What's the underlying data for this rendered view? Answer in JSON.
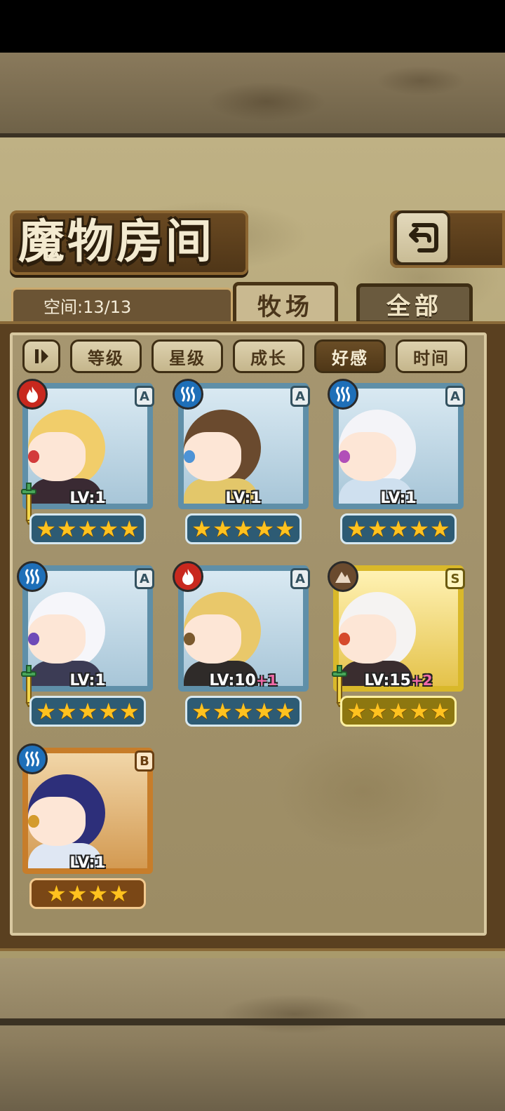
{
  "header": {
    "title": "魔物房间"
  },
  "space": {
    "label": "空间:13/13"
  },
  "tabs": [
    {
      "label": "牧场",
      "active": true
    },
    {
      "label": "全部",
      "active": false
    }
  ],
  "filters": [
    {
      "label": "等级",
      "active": false
    },
    {
      "label": "星级",
      "active": false
    },
    {
      "label": "成长",
      "active": false
    },
    {
      "label": "好感",
      "active": true
    },
    {
      "label": "时间",
      "active": false
    }
  ],
  "cards": [
    {
      "element": "fire",
      "grade": "A",
      "level": "LV:1",
      "plus": "",
      "stars": 5,
      "frame": "silver",
      "has_sword": true,
      "hair": "#f1cd6a",
      "eyes": "#d33b3b",
      "outfit": "#3a2a33"
    },
    {
      "element": "water",
      "grade": "A",
      "level": "LV:1",
      "plus": "",
      "stars": 5,
      "frame": "silver",
      "has_sword": false,
      "hair": "#6a4a2e",
      "eyes": "#4d93d6",
      "outfit": "#e3c76a"
    },
    {
      "element": "water",
      "grade": "A",
      "level": "LV:1",
      "plus": "",
      "stars": 5,
      "frame": "silver",
      "has_sword": false,
      "hair": "#f4f4f8",
      "eyes": "#b14fb8",
      "outfit": "#cfe0ef"
    },
    {
      "element": "water",
      "grade": "A",
      "level": "LV:1",
      "plus": "",
      "stars": 5,
      "frame": "silver",
      "has_sword": true,
      "hair": "#f6f6fa",
      "eyes": "#6f4bb8",
      "outfit": "#3c3c55"
    },
    {
      "element": "fire",
      "grade": "A",
      "level": "LV:10",
      "plus": "+1",
      "stars": 5,
      "frame": "silver",
      "has_sword": false,
      "hair": "#e9c86a",
      "eyes": "#7b5a2f",
      "outfit": "#2f2b29"
    },
    {
      "element": "earth",
      "grade": "S",
      "level": "LV:15",
      "plus": "+2",
      "stars": 5,
      "frame": "gold",
      "has_sword": true,
      "hair": "#f5f3f2",
      "eyes": "#d64a2c",
      "outfit": "#3a2d2f"
    },
    {
      "element": "water",
      "grade": "B",
      "level": "LV:1",
      "plus": "",
      "stars": 4,
      "frame": "bronze",
      "has_sword": false,
      "hair": "#2d2f7a",
      "eyes": "#d49b2c",
      "outfit": "#dfe7f3"
    }
  ],
  "colors": {
    "fire": "#c8281e",
    "water": "#1e6fb8",
    "earth": "#6a4a2e"
  },
  "icons": {
    "back": "return-arrow-icon",
    "toggle": "pause-sort-icon",
    "fire": "flame-icon",
    "water": "wave-icon",
    "earth": "mountain-icon",
    "star": "star-icon",
    "sword": "sword-icon"
  }
}
